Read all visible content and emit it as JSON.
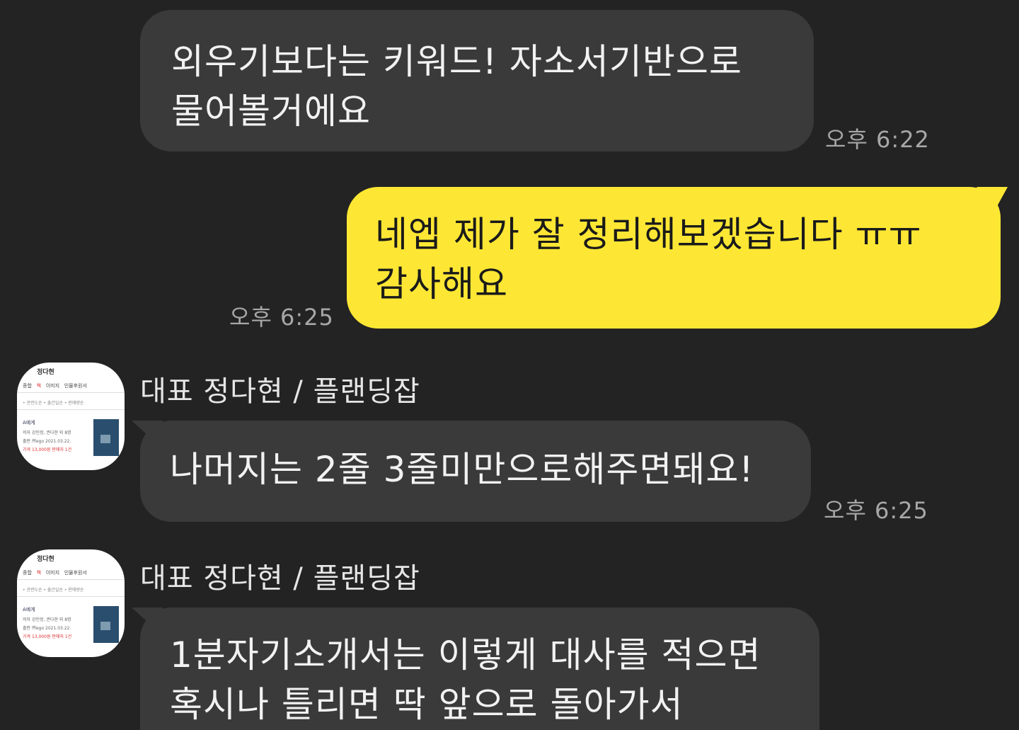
{
  "messages": [
    {
      "id": "m1",
      "direction": "in",
      "lines": [
        "외우기보다는 키워드! 자소서기반으로",
        "물어볼거에요"
      ],
      "time": "오후 6:22"
    },
    {
      "id": "m2",
      "direction": "out",
      "lines": [
        "네엡 제가 잘 정리해보겠습니다 ㅠㅠ",
        "감사해요"
      ],
      "time": "오후 6:25"
    },
    {
      "id": "m3",
      "direction": "in",
      "sender": "대표 정다현 / 플랜딩잡",
      "lines": [
        "나머지는 2줄 3줄미만으로해주면돼요!"
      ],
      "time": "오후 6:25"
    },
    {
      "id": "m4",
      "direction": "in",
      "sender": "대표 정다현 / 플랜딩잡",
      "lines": [
        "1분자기소개서는 이렇게 대사를 적으면",
        "혹시나 틀리면 딱 앞으로 돌아가서"
      ]
    }
  ],
  "avatar": {
    "title": "정다현",
    "tabs": [
      "종합",
      "책",
      "이미지",
      "인물후원서"
    ],
    "subnav": "• 관련도순   • 출간일순   • 판매량순",
    "book_title": "A예게",
    "meta": [
      "저자  강민정, 권다현 외 8명",
      "출판  ㈜ego    2021.03.22.",
      "가격  13,000원  판매처 1건"
    ]
  },
  "colors": {
    "background": "#232323",
    "incoming_bubble": "#3a3a3a",
    "outgoing_bubble": "#fee734",
    "timestamp": "#a7a7a7"
  }
}
